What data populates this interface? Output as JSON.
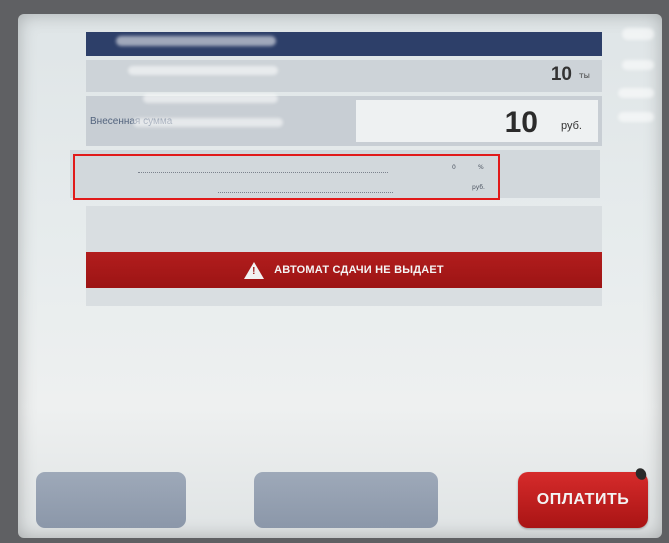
{
  "header": {
    "title": ""
  },
  "amount_row": {
    "label": "",
    "value": "10",
    "unit": "ты"
  },
  "deposit_row": {
    "label": "Внесенная сумма",
    "value": "10",
    "unit": "руб."
  },
  "details": {
    "commission_label": "",
    "commission_value": "0",
    "commission_unit": "%",
    "to_credit_label": "",
    "to_credit_value": "",
    "to_credit_unit": "руб."
  },
  "notes": {
    "line1": "",
    "line2": "",
    "line3": ""
  },
  "warning": {
    "text": "АВТОМАТ СДАЧИ НЕ ВЫДАЕТ",
    "icon": "warning-icon"
  },
  "limit": {
    "text": ""
  },
  "buttons": {
    "pay_label": "ОПЛАТИТЬ",
    "left_label": "",
    "middle_label": ""
  },
  "colors": {
    "header": "#2d3f69",
    "warning": "#a31616",
    "pay": "#c11f1f",
    "highlight_frame": "#e11a1a"
  }
}
